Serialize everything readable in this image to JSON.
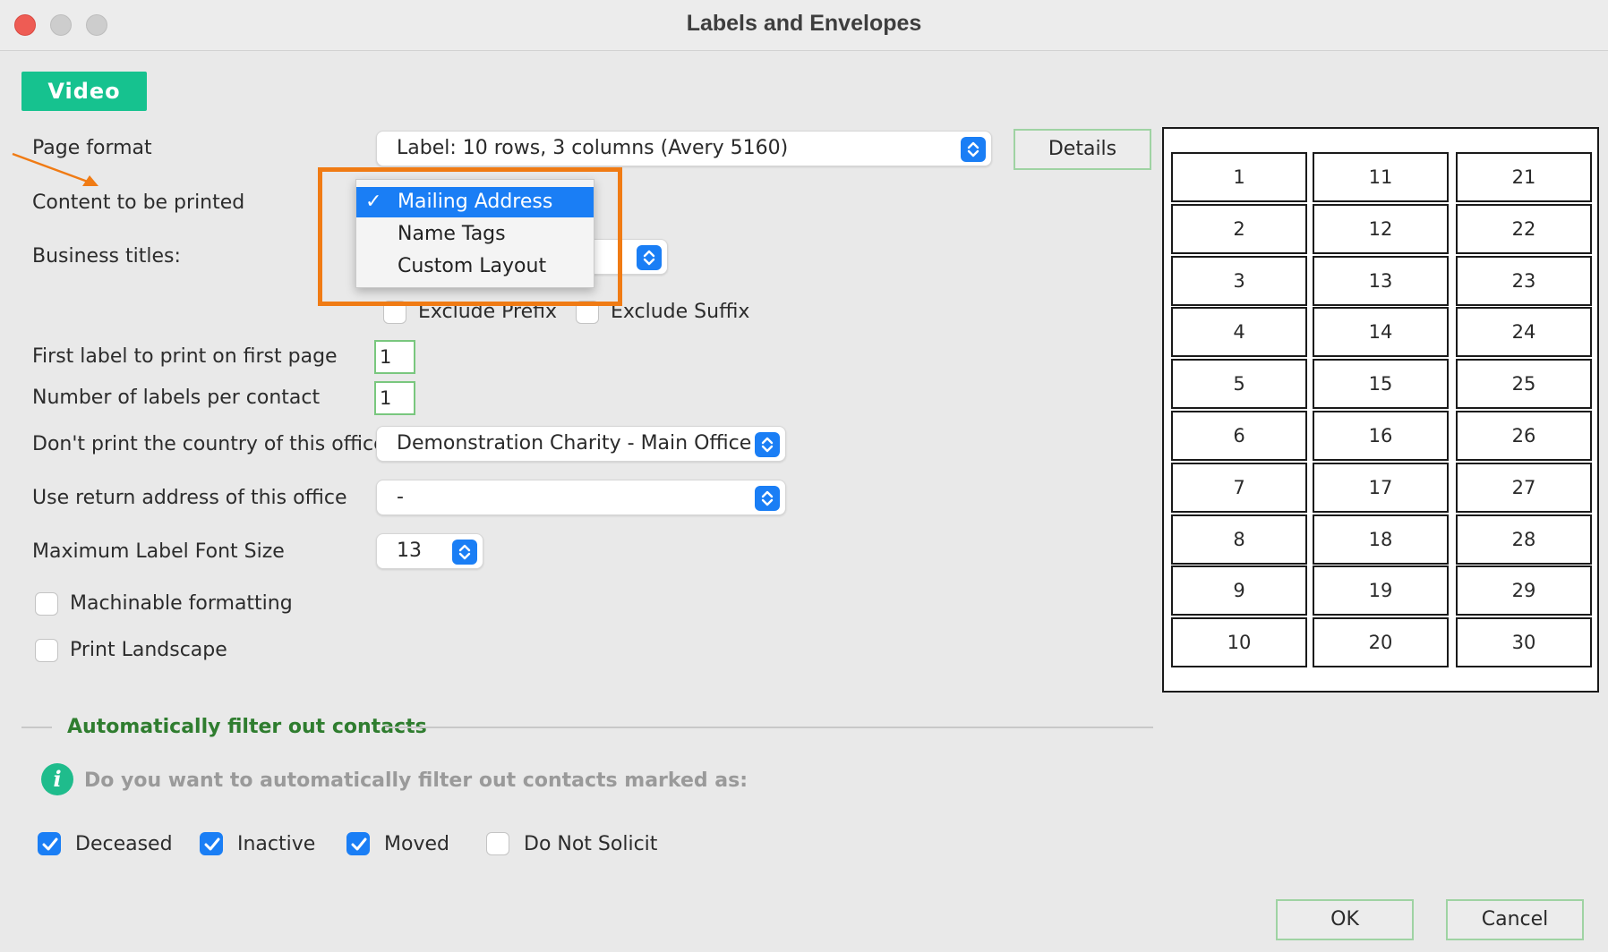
{
  "window": {
    "title": "Labels and Envelopes"
  },
  "video_button": "Video",
  "form": {
    "page_format_label": "Page format",
    "page_format_value": "Label: 10 rows, 3 columns (Avery 5160)",
    "details_button": "Details",
    "content_label": "Content to be printed",
    "business_titles_label": "Business titles:",
    "exclude_prefix": "Exclude Prefix",
    "exclude_suffix": "Exclude Suffix",
    "first_label_label": "First label to print on first page",
    "first_label_value": "1",
    "labels_per_contact_label": "Number of labels per contact",
    "labels_per_contact_value": "1",
    "dont_print_country_label": "Don't print the country of this office",
    "dont_print_country_value": "Demonstration Charity - Main Office",
    "return_address_label": "Use return address of this office",
    "return_address_value": "-",
    "max_font_label": "Maximum Label Font Size",
    "max_font_value": "13",
    "machinable_label": "Machinable formatting",
    "landscape_label": "Print Landscape"
  },
  "dropdown": {
    "items": [
      "Mailing Address",
      "Name Tags",
      "Custom Layout"
    ],
    "selected": "Mailing Address",
    "check": "✓"
  },
  "label_grid": {
    "columns": [
      [
        "1",
        "2",
        "3",
        "4",
        "5",
        "6",
        "7",
        "8",
        "9",
        "10"
      ],
      [
        "11",
        "12",
        "13",
        "14",
        "15",
        "16",
        "17",
        "18",
        "19",
        "20"
      ],
      [
        "21",
        "22",
        "23",
        "24",
        "25",
        "26",
        "27",
        "28",
        "29",
        "30"
      ]
    ]
  },
  "filter_section": {
    "title": "Automatically filter out contacts",
    "info_icon": "i",
    "question": "Do you want to automatically filter out contacts marked as:",
    "options": [
      {
        "label": "Deceased",
        "checked": true
      },
      {
        "label": "Inactive",
        "checked": true
      },
      {
        "label": "Moved",
        "checked": true
      },
      {
        "label": "Do Not Solicit",
        "checked": false
      }
    ]
  },
  "buttons": {
    "ok": "OK",
    "cancel": "Cancel"
  },
  "colors": {
    "accent": "#1a7ef5",
    "video_green": "#16c28f",
    "highlight_orange": "#f07b14",
    "section_green": "#2f7d2f"
  }
}
